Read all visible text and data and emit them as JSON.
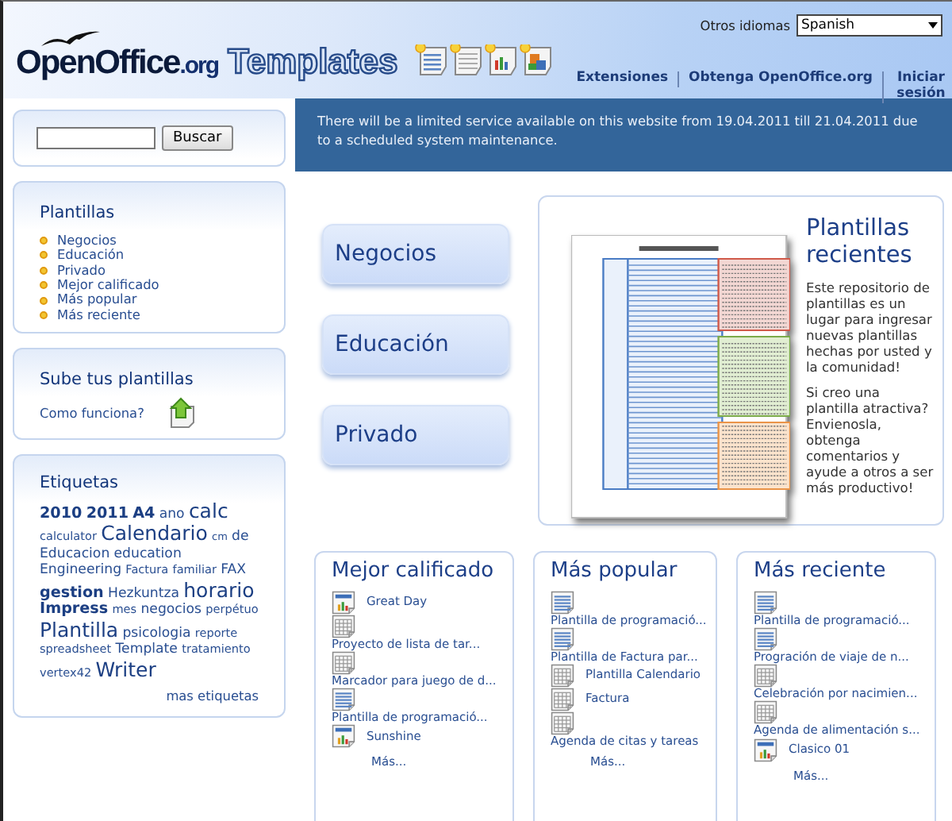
{
  "header": {
    "logo": {
      "brand": "OpenOffice",
      "suffix": ".org",
      "product": "Templates"
    },
    "language": {
      "label": "Otros idiomas",
      "value": "Spanish"
    },
    "nav": [
      "Extensiones",
      "Obtenga OpenOffice.org",
      "Iniciar sesión"
    ]
  },
  "search": {
    "button": "Buscar"
  },
  "notice": "There will be a limited service available on this website from 19.04.2011 till 21.04.2011 due to a scheduled system maintenance.",
  "sidebar": {
    "templates": {
      "title": "Plantillas",
      "items": [
        "Negocios",
        "Educación",
        "Privado",
        "Mejor calificado",
        "Más popular",
        "Más reciente"
      ]
    },
    "upload": {
      "title": "Sube tus plantillas",
      "link": "Como funciona?"
    },
    "tags": {
      "title": "Etiquetas",
      "items": [
        {
          "text": "2010",
          "kind": "large"
        },
        {
          "text": "2011",
          "kind": "large"
        },
        {
          "text": "A4",
          "kind": "large"
        },
        {
          "text": "ano",
          "kind": "medium"
        },
        {
          "text": "calc",
          "kind": "huge"
        },
        {
          "text": "calculator",
          "kind": "small"
        },
        {
          "text": "Calendario",
          "kind": "huge"
        },
        {
          "text": "cm",
          "kind": "tiny"
        },
        {
          "text": "de",
          "kind": "medium"
        },
        {
          "text": "Educacion",
          "kind": "medium"
        },
        {
          "text": "education",
          "kind": "medium"
        },
        {
          "text": "Engineering",
          "kind": "medium"
        },
        {
          "text": "Factura",
          "kind": "small"
        },
        {
          "text": "familiar",
          "kind": "small"
        },
        {
          "text": "FAX",
          "kind": "medium"
        },
        {
          "text": "gestion",
          "kind": "large"
        },
        {
          "text": "Hezkuntza",
          "kind": "medium"
        },
        {
          "text": "horario",
          "kind": "huge"
        },
        {
          "text": "Impress",
          "kind": "large"
        },
        {
          "text": "mes",
          "kind": "small"
        },
        {
          "text": "negocios",
          "kind": "medium"
        },
        {
          "text": "perpétuo",
          "kind": "small"
        },
        {
          "text": "Plantilla",
          "kind": "huge"
        },
        {
          "text": "psicologia",
          "kind": "medium"
        },
        {
          "text": "reporte",
          "kind": "small"
        },
        {
          "text": "spreadsheet",
          "kind": "small"
        },
        {
          "text": "Template",
          "kind": "medium"
        },
        {
          "text": "tratamiento",
          "kind": "small"
        },
        {
          "text": "vertex42",
          "kind": "small"
        },
        {
          "text": "Writer",
          "kind": "huge"
        }
      ],
      "more": "mas etiquetas"
    }
  },
  "categories": [
    "Negocios",
    "Educación",
    "Privado"
  ],
  "recent_intro": {
    "title": "Plantillas recientes",
    "paragraphs": [
      "Este repositorio de plantillas es un lugar para ingresar nuevas plantillas hechas por usted y la comunidad!",
      "Si creo una plantilla atractiva? Envienosla, obtenga comentarios y ayude a otros a ser más productivo!"
    ]
  },
  "lists": [
    {
      "title": "Mejor calificado",
      "items": [
        {
          "kind": "chart",
          "title": "Great Day"
        },
        {
          "kind": "grid",
          "title": "Proyecto de lista de tar..."
        },
        {
          "kind": "grid",
          "title": "Marcador para juego de d..."
        },
        {
          "kind": "text",
          "title": "Plantilla de programació..."
        },
        {
          "kind": "chart",
          "title": "Sunshine"
        }
      ],
      "more": "Más..."
    },
    {
      "title": "Más popular",
      "items": [
        {
          "kind": "text",
          "title": "Plantilla de programació..."
        },
        {
          "kind": "text",
          "title": "Plantilla de Factura par..."
        },
        {
          "kind": "grid",
          "title": "Plantilla Calendario"
        },
        {
          "kind": "grid",
          "title": "Factura"
        },
        {
          "kind": "grid",
          "title": "Agenda de citas y tareas"
        }
      ],
      "more": "Más..."
    },
    {
      "title": "Más reciente",
      "items": [
        {
          "kind": "text",
          "title": "Plantilla de programació..."
        },
        {
          "kind": "text",
          "title": "Progración de viaje de n..."
        },
        {
          "kind": "grid",
          "title": "Celebración por nacimien..."
        },
        {
          "kind": "grid",
          "title": "Agenda de alimentación s..."
        },
        {
          "kind": "chart",
          "title": "Clasico 01"
        }
      ],
      "more": "Más..."
    }
  ]
}
